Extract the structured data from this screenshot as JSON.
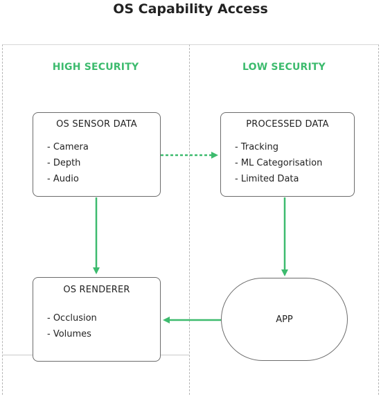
{
  "title": "OS Capability Access",
  "sections": {
    "high": "HIGH SECURITY",
    "low": "LOW SECURITY"
  },
  "nodes": {
    "sensor": {
      "title": "OS SENSOR DATA",
      "items": [
        "- Camera",
        "- Depth",
        "- Audio"
      ]
    },
    "processed": {
      "title": "PROCESSED DATA",
      "items": [
        "- Tracking",
        "- ML Categorisation",
        "- Limited Data"
      ]
    },
    "renderer": {
      "title": "OS RENDERER",
      "items": [
        "- Occlusion",
        "- Volumes"
      ]
    },
    "app": {
      "label": "APP"
    }
  },
  "edges": [
    {
      "from": "OS SENSOR DATA",
      "to": "PROCESSED DATA",
      "style": "dashed"
    },
    {
      "from": "OS SENSOR DATA",
      "to": "OS RENDERER",
      "style": "solid"
    },
    {
      "from": "PROCESSED DATA",
      "to": "APP",
      "style": "solid"
    },
    {
      "from": "APP",
      "to": "OS RENDERER",
      "style": "solid"
    }
  ],
  "colors": {
    "accent": "#3dbb6e",
    "border": "#6b6b6b",
    "divider": "#b5b5b5",
    "text": "#222222"
  }
}
